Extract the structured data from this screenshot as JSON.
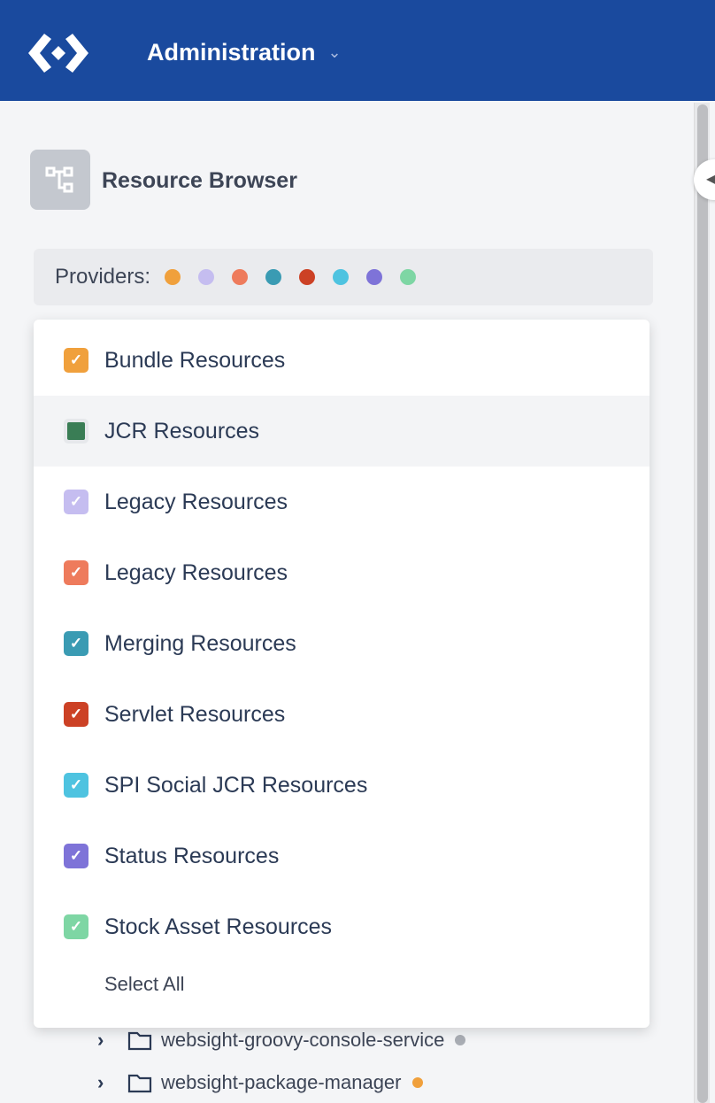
{
  "header": {
    "title": "Administration",
    "logo": "websight-logo",
    "dropdown_icon": "chevron-down-icon",
    "background": "#1A4A9E"
  },
  "panel": {
    "title": "Resource Browser",
    "icon": "tree-structure-icon"
  },
  "providers": {
    "label": "Providers:",
    "dots": [
      "#F0A03C",
      "#C5BDF0",
      "#EE7B5C",
      "#3A9BB3",
      "#CC4125",
      "#4EC3E0",
      "#7E73D8",
      "#7ED6A4"
    ]
  },
  "dropdown": {
    "items": [
      {
        "label": "Bundle Resources",
        "checked": true,
        "color": "#F0A03C"
      },
      {
        "label": "JCR Resources",
        "checked": false,
        "color": "#3A7D55",
        "hovered": true
      },
      {
        "label": "Legacy Resources",
        "checked": true,
        "color": "#C5BDF0"
      },
      {
        "label": "Legacy Resources",
        "checked": true,
        "color": "#EE7B5C"
      },
      {
        "label": "Merging Resources",
        "checked": true,
        "color": "#3A9BB3"
      },
      {
        "label": "Servlet Resources",
        "checked": true,
        "color": "#CC4125"
      },
      {
        "label": "SPI Social JCR Resources",
        "checked": true,
        "color": "#4EC3E0"
      },
      {
        "label": "Status Resources",
        "checked": true,
        "color": "#7E73D8"
      },
      {
        "label": "Stock Asset Resources",
        "checked": true,
        "color": "#7ED6A4"
      }
    ],
    "select_all": "Select All"
  },
  "tree": [
    {
      "label": "websight-groovy-console-service",
      "dot": "#A9ADB4"
    },
    {
      "label": "websight-package-manager",
      "dot": "#F0A03C"
    }
  ]
}
